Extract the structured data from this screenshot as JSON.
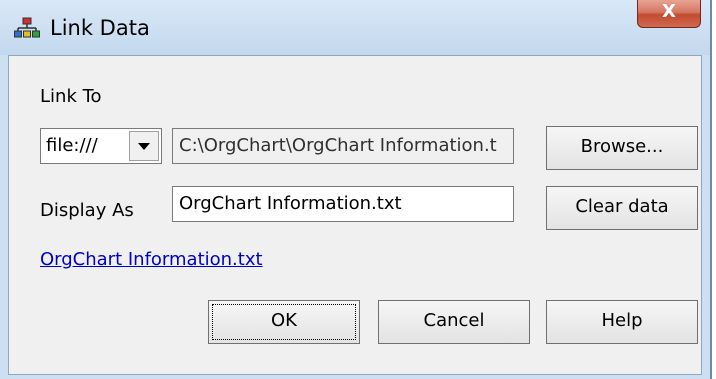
{
  "window": {
    "title": "Link Data",
    "close_glyph": "X"
  },
  "link_to": {
    "label": "Link To",
    "protocol_selected": "file:///",
    "path_value": "C:\\OrgChart\\OrgChart Information.t"
  },
  "display_as": {
    "label": "Display As",
    "value": "OrgChart Information.txt"
  },
  "preview_link": "OrgChart Information.txt",
  "buttons": {
    "browse": "Browse...",
    "clear_data": "Clear data",
    "ok": "OK",
    "cancel": "Cancel",
    "help": "Help"
  },
  "colors": {
    "link": "#0000cc",
    "title_bar": "#c3d8ee",
    "close_button": "#c24a30"
  },
  "icons": {
    "app_icon": "org-chart-icon",
    "dropdown": "chevron-down-icon"
  }
}
